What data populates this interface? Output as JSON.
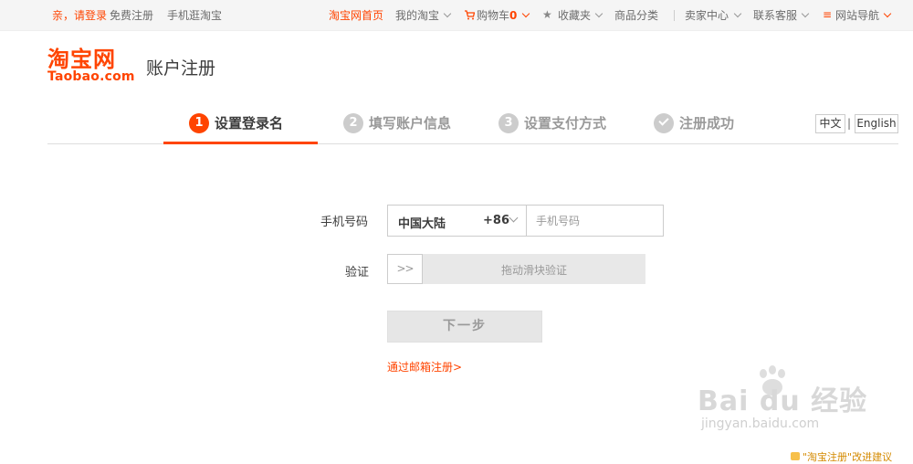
{
  "topbar": {
    "greeting": "亲，请登录",
    "free_register": "免费注册",
    "mobile": "手机逛淘宝",
    "home": "淘宝网首页",
    "my_taobao": "我的淘宝",
    "cart": "购物车",
    "cart_count": "0",
    "favorites": "收藏夹",
    "categories": "商品分类",
    "seller_center": "卖家中心",
    "contact": "联系客服",
    "site_nav": "网站导航"
  },
  "logo": {
    "cn": "淘宝网",
    "en": "Taobao.com"
  },
  "page_title": "账户注册",
  "steps": [
    {
      "num": "1",
      "label": "设置登录名",
      "active": true
    },
    {
      "num": "2",
      "label": "填写账户信息",
      "active": false
    },
    {
      "num": "3",
      "label": "设置支付方式",
      "active": false
    },
    {
      "num": "",
      "label": "注册成功",
      "active": false,
      "icon": "check-icon"
    }
  ],
  "lang": {
    "zh": "中文",
    "sep": "|",
    "en": "English"
  },
  "form": {
    "phone_label": "手机号码",
    "country": "中国大陆",
    "country_code": "+86",
    "phone_placeholder": "手机号码",
    "phone_value": "",
    "verify_label": "验证",
    "slider_handle": ">>",
    "slider_text": "拖动滑块验证",
    "next_button": "下一步",
    "email_link": "通过邮箱注册>"
  },
  "watermark": {
    "big": "Bai du 经验",
    "small": "jingyan.baidu.com"
  },
  "feedback": "\"淘宝注册\"改进建议"
}
